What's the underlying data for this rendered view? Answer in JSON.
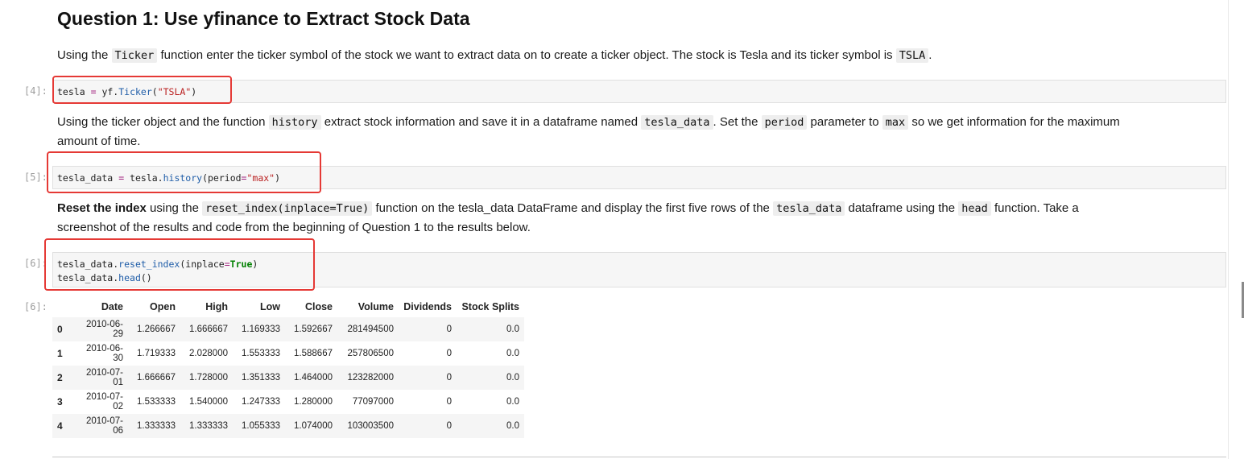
{
  "heading": "Question 1: Use yfinance to Extract Stock Data",
  "para1": {
    "t1": "Using the ",
    "c1": "Ticker",
    "t2": " function enter the ticker symbol of the stock we want to extract data on to create a ticker object. The stock is Tesla and its ticker symbol is ",
    "c2": "TSLA",
    "t3": "."
  },
  "cell4": {
    "prompt": "[4]:",
    "var": "tesla",
    "op": "=",
    "obj": "yf.",
    "func": "Ticker",
    "open": "(",
    "arg": "\"TSLA\"",
    "close": ")"
  },
  "para2": {
    "t1": "Using the ticker object and the function ",
    "c1": "history",
    "t2": " extract stock information and save it in a dataframe named ",
    "c2": "tesla_data",
    "t3": ". Set the ",
    "c3": "period",
    "t4": " parameter to ",
    "c4": "max",
    "t5": " so we get information for the maximum",
    "t6": "amount of time."
  },
  "cell5": {
    "prompt": "[5]:",
    "var": "tesla_data",
    "op": "=",
    "obj": "tesla.",
    "func": "history",
    "open": "(period",
    "eq": "=",
    "arg": "\"max\"",
    "close": ")"
  },
  "para3": {
    "bold": "Reset the index",
    "t1": " using the ",
    "c1": "reset_index(inplace=True)",
    "t2": " function on the tesla_data DataFrame and display the first five rows of the ",
    "c2": "tesla_data",
    "t3": " dataframe using the ",
    "c3": "head",
    "t4": " function. Take a",
    "t5": "screenshot of the results and code from the beginning of Question 1 to the results below."
  },
  "cell6": {
    "prompt": "[6]:",
    "line1_obj": "tesla_data.",
    "line1_func": "reset_index",
    "line1_open": "(inplace",
    "line1_eq": "=",
    "line1_kw": "True",
    "line1_close": ")",
    "line2_obj": "tesla_data.",
    "line2_func": "head",
    "line2_close": "()"
  },
  "output6": {
    "prompt": "[6]:",
    "columns": [
      "",
      "Date",
      "Open",
      "High",
      "Low",
      "Close",
      "Volume",
      "Dividends",
      "Stock Splits"
    ],
    "rows": [
      [
        "0",
        "2010-06-29",
        "1.266667",
        "1.666667",
        "1.169333",
        "1.592667",
        "281494500",
        "0",
        "0.0"
      ],
      [
        "1",
        "2010-06-30",
        "1.719333",
        "2.028000",
        "1.553333",
        "1.588667",
        "257806500",
        "0",
        "0.0"
      ],
      [
        "2",
        "2010-07-01",
        "1.666667",
        "1.728000",
        "1.351333",
        "1.464000",
        "123282000",
        "0",
        "0.0"
      ],
      [
        "3",
        "2010-07-02",
        "1.533333",
        "1.540000",
        "1.247333",
        "1.280000",
        "77097000",
        "0",
        "0.0"
      ],
      [
        "4",
        "2010-07-06",
        "1.333333",
        "1.333333",
        "1.055333",
        "1.074000",
        "103003500",
        "0",
        "0.0"
      ]
    ]
  },
  "colors": {
    "highlight": "#e53935",
    "string": "#ba2121",
    "attr": "#1f5da8",
    "keyword": "#008000",
    "operator": "#a2237f"
  }
}
